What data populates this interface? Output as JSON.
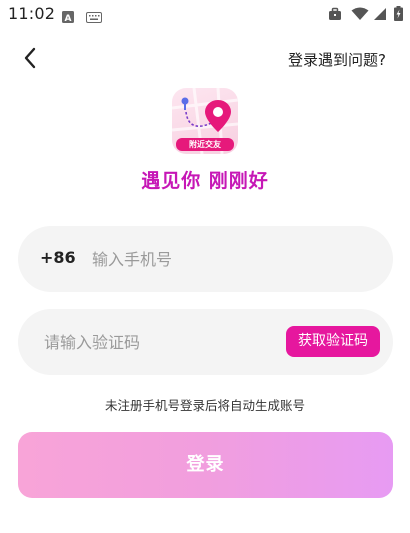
{
  "status_bar": {
    "time": "11:02",
    "left_icons": [
      "a-notification-icon",
      "keyboard-icon"
    ],
    "right_icons": [
      "briefcase-icon",
      "wifi-icon",
      "cell-signal-icon",
      "battery-charging-icon"
    ]
  },
  "header": {
    "back_icon": "chevron-left-icon",
    "help_link": "登录遇到问题?"
  },
  "logo": {
    "badge_text": "附近交友",
    "icon": "map-pin-icon"
  },
  "tagline": "遇见你 刚刚好",
  "phone_field": {
    "country_code": "+86",
    "placeholder": "输入手机号",
    "value": ""
  },
  "code_field": {
    "placeholder": "请输入验证码",
    "value": "",
    "get_code_label": "获取验证码"
  },
  "note": "未注册手机号登录后将自动生成账号",
  "login_button": "登录",
  "colors": {
    "accent": "#e6179e",
    "tagline": "#c617b6",
    "field_bg": "#f4f4f4",
    "login_gradient_start": "#f8a4d8",
    "login_gradient_end": "#e79bf3"
  }
}
